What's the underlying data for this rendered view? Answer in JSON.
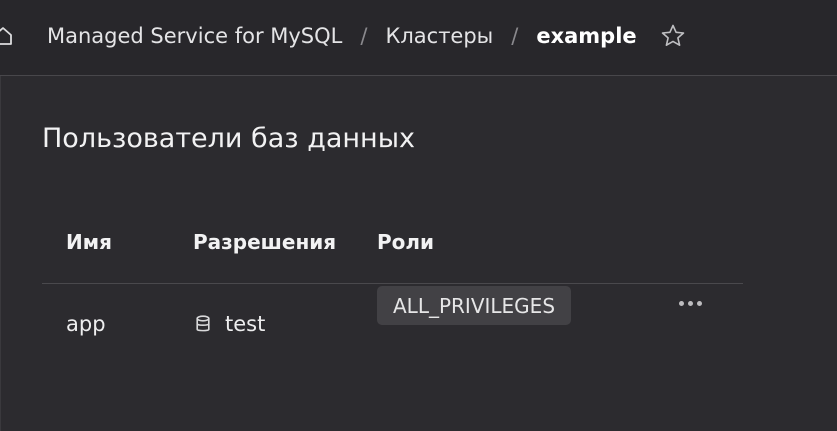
{
  "breadcrumb": {
    "service": "Managed Service for MySQL",
    "separator": "/",
    "clusters": "Кластеры",
    "current": "example"
  },
  "icons": {
    "home": "home-icon",
    "star": "star-outline-icon",
    "database": "database-icon",
    "more": "more-horizontal-icon"
  },
  "page": {
    "title": "Пользователи баз данных"
  },
  "table": {
    "columns": [
      "Имя",
      "Разрешения",
      "Роли"
    ],
    "rows": [
      {
        "name": "app",
        "permission": "test",
        "role": "ALL_PRIVILEGES"
      }
    ]
  },
  "colors": {
    "background": "#28272b",
    "panel": "#2c2b2f",
    "text": "#e9e9ea",
    "badge": "#424145",
    "divider": "#4a494d"
  }
}
